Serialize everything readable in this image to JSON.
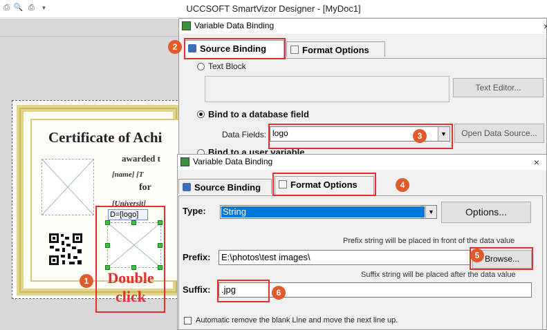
{
  "app": {
    "title": "UCCSOFT SmartVizor Designer - [MyDoc1]"
  },
  "certificate": {
    "title": "Certificate of Achi",
    "awarded": "awarded t",
    "name_field": "[name]  [T",
    "for_text": "for",
    "university_field": "[Universit]",
    "logo_label": "D=[logo]"
  },
  "annotations": {
    "double_click_line1": "Double",
    "double_click_line2": "click",
    "steps": [
      "1",
      "2",
      "3",
      "4",
      "5",
      "6"
    ]
  },
  "dialog_source": {
    "title": "Variable Data Binding",
    "tabs": {
      "source_binding": "Source Binding",
      "format_options": "Format Options"
    },
    "text_block_label": "Text Block",
    "text_editor_button": "Text Editor...",
    "bind_db_label": "Bind to a database field",
    "data_fields_label": "Data Fields:",
    "data_fields_value": "logo",
    "open_data_source_button": "Open Data Source...",
    "bind_user_variable_label": "Bind to a user variable"
  },
  "dialog_format": {
    "title": "Variable Data Binding",
    "close_glyph": "×",
    "tabs": {
      "source_binding": "Source Binding",
      "format_options": "Format Options"
    },
    "type_label": "Type:",
    "type_value": "String",
    "options_button": "Options...",
    "prefix_hint": "Prefix string will be placed in front of the data value",
    "prefix_label": "Prefix:",
    "prefix_value": "E:\\photos\\test images\\",
    "browse_button": "Browse...",
    "suffix_hint": "Suffix string will be placed after the data value",
    "suffix_label": "Suffix:",
    "suffix_value": ".jpg",
    "auto_remove_label": "Automatic remove the blank Line and move the next line up."
  },
  "colors": {
    "annotation_red": "#e0312d",
    "step_badge": "#e05a2c",
    "selection_blue": "#0078d7",
    "cert_gold": "#e2d58a"
  }
}
